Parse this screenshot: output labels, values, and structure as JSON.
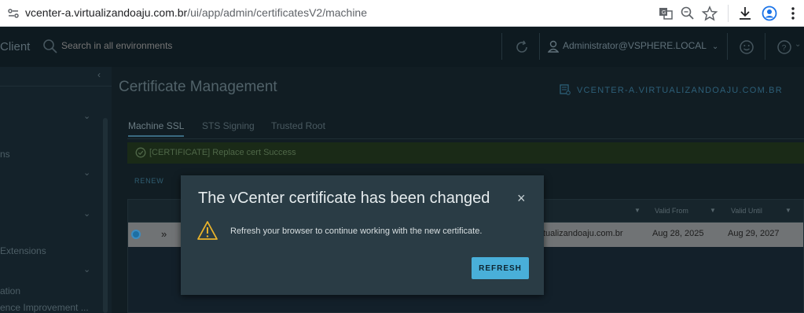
{
  "browser": {
    "url_host": "vcenter-a.virtualizandoaju.com.br",
    "url_path": "/ui/app/admin/certificatesV2/machine",
    "icons": [
      "site-info-icon",
      "translate-icon",
      "zoom-icon",
      "bookmark-star-icon",
      "download-icon",
      "profile-icon",
      "menu-icon"
    ]
  },
  "header": {
    "app_name": "Client",
    "search_placeholder": "Search in all environments",
    "user": "Administrator@VSPHERE.LOCAL",
    "icons": [
      "search-icon",
      "refresh-icon",
      "user-icon",
      "chevron-down-icon",
      "smiley-icon",
      "help-icon"
    ]
  },
  "sidebar": {
    "items": [
      {
        "label": "ns"
      },
      {
        "label": "Extensions"
      },
      {
        "label": "ation"
      },
      {
        "label": "ence Improvement ..."
      }
    ]
  },
  "main": {
    "title": "Certificate Management",
    "vcenter_name": "VCENTER-A.VIRTUALIZANDOAJU.COM.BR",
    "tabs": [
      {
        "label": "Machine SSL",
        "active": true
      },
      {
        "label": "STS Signing",
        "active": false
      },
      {
        "label": "Trusted Root",
        "active": false
      }
    ],
    "alert": "[CERTIFICATE] Replace cert Success",
    "renew_label": "RENEW",
    "grid": {
      "columns": [
        "Valid From",
        "Valid Until"
      ],
      "row": {
        "subject": "tualizandoaju.com.br",
        "valid_from": "Aug 28, 2025",
        "valid_until": "Aug 29, 2027"
      }
    }
  },
  "modal": {
    "title": "The vCenter certificate has been changed",
    "message": "Refresh your browser to continue working with the new certificate.",
    "button": "REFRESH",
    "close_symbol": "×"
  },
  "colors": {
    "accent": "#49afd9",
    "warning": "#e9b32b",
    "modal_bg": "#2a3c45"
  }
}
